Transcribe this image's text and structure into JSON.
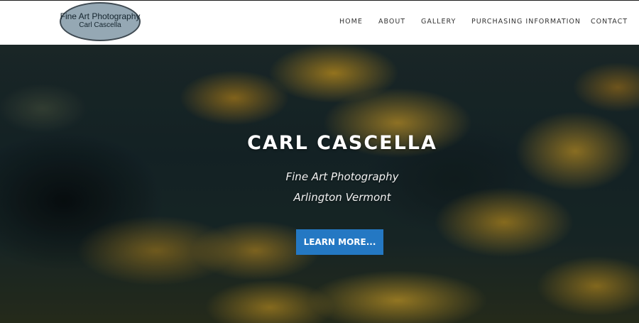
{
  "logo": {
    "line1": "Fine Art Photography",
    "line2": "Carl Cascella"
  },
  "nav": {
    "items": [
      {
        "label": "HOME"
      },
      {
        "label": "ABOUT"
      },
      {
        "label": "GALLERY"
      },
      {
        "label": "PURCHASING INFORMATION"
      },
      {
        "label": "CONTACT"
      }
    ]
  },
  "hero": {
    "title": "CARL CASCELLA",
    "subtitle_line1": "Fine Art Photography",
    "subtitle_line2": "Arlington Vermont",
    "button_label": "LEARN MORE...",
    "button_color": "#2478c3"
  },
  "colors": {
    "header_bg": "#ffffff",
    "logo_fill": "#95a8b4",
    "nav_text": "#333333"
  }
}
